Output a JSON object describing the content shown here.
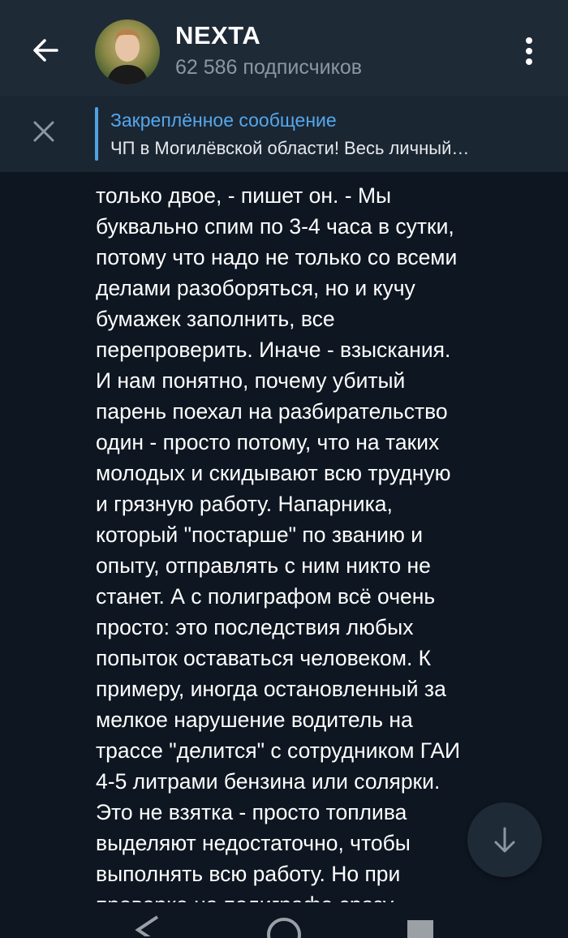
{
  "header": {
    "title": "NEXTA",
    "subtitle": "62 586 подписчиков",
    "back_icon": "arrow-left-icon",
    "menu_icon": "more-vertical-icon"
  },
  "pinned": {
    "title": "Закреплённое сообщение",
    "text": "ЧП в Могилёвской области! Весь личный…",
    "close_icon": "close-icon"
  },
  "message": {
    "lines": [
      "только двое, - пишет он. - Мы",
      "буквально спим по 3-4 часа в сутки,",
      "потому что надо не только со всеми",
      "делами разоборяться, но и кучу",
      "бумажек заполнить, все",
      "перепроверить. Иначе - взыскания.",
      "И нам понятно, почему убитый",
      "парень поехал на разбирательство",
      "один - просто потому, что на таких",
      "молодых и скидывают всю трудную",
      "и грязную работу. Напарника,",
      "который \"постарше\" по званию и",
      "опыту, отправлять с ним никто не",
      "станет. А с полиграфом всё очень",
      "просто: это последствия любых",
      "попыток оставаться человеком. К",
      "примеру, иногда остановленный за",
      "мелкое нарушение водитель на",
      "трассе \"делится\" с сотрудником ГАИ",
      "4-5 литрами бензина или солярки.",
      "Это не взятка - просто топлива",
      "выделяют недостаточно, чтобы",
      "выполнять всю работу. Но при",
      "проверке на полиграфе сразу"
    ]
  },
  "scroll_button": {
    "icon": "arrow-down-icon"
  },
  "colors": {
    "background": "#0e1621",
    "header": "#1f2a37",
    "accent": "#55a8ec",
    "subtitle": "#8b97a5"
  }
}
